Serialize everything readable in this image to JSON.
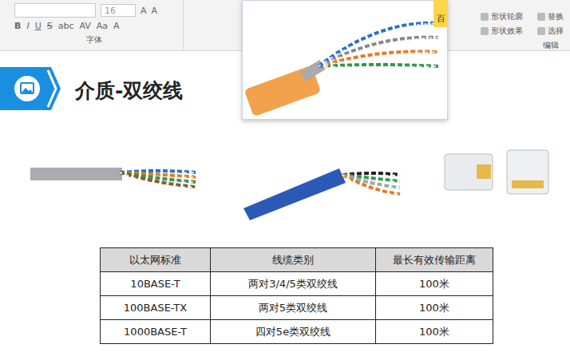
{
  "ribbon": {
    "font_size": "16",
    "size_buttons": [
      "A",
      "A"
    ],
    "format_buttons": [
      "B",
      "I",
      "U",
      "S",
      "abc",
      "AV",
      "Aa",
      "A"
    ],
    "font_group_label": "字体",
    "shape_items": [
      "形状轮廓",
      "形状效果"
    ],
    "edit_items": [
      "替换",
      "选择"
    ],
    "edit_group_label": "编辑"
  },
  "popup": {
    "badge": "百"
  },
  "slide": {
    "title": "介质-双绞线"
  },
  "table": {
    "columns": [
      "以太网标准",
      "线缆类别",
      "最长有效传输距离"
    ],
    "rows": [
      [
        "10BASE-T",
        "两对3/4/5类双绞线",
        "100米"
      ],
      [
        "100BASE-TX",
        "两对5类双绞线",
        "100米"
      ],
      [
        "1000BASE-T",
        "四对5e类双绞线",
        "100米"
      ]
    ]
  }
}
